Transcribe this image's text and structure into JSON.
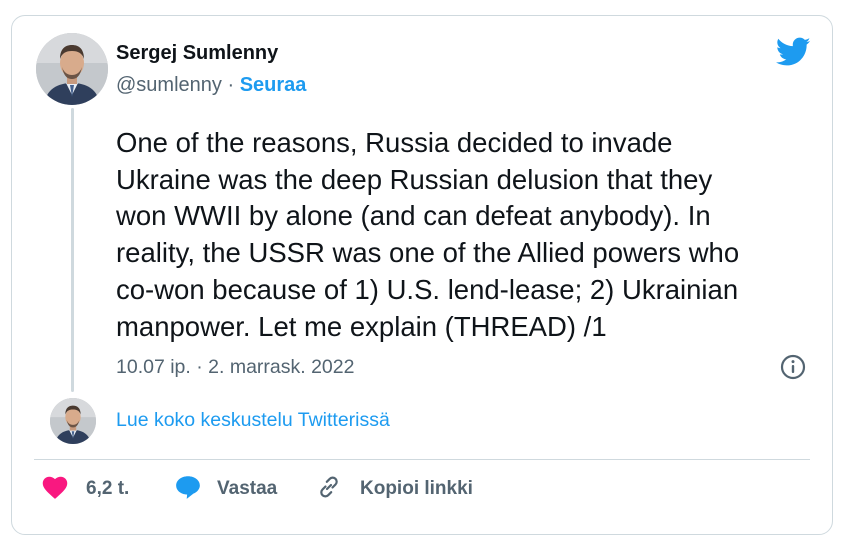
{
  "author": {
    "name": "Sergej Sumlenny",
    "handle": "@sumlenny",
    "separator": " · ",
    "follow_label": "Seuraa"
  },
  "tweet": {
    "lines": [
      "One of the reasons, Russia decided to invade",
      "Ukraine was the deep Russian delusion that they",
      "won WWII by alone (and can defeat anybody). In",
      "reality, the USSR was one of the Allied powers who",
      "co-won because of 1) U.S. lend-lease; 2) Ukrainian",
      "manpower. Let me explain (THREAD) /1"
    ],
    "timestamp": "10.07 ip. · 2. marrask. 2022"
  },
  "thread": {
    "read_more_label": "Lue koko keskustelu Twitterissä"
  },
  "actions": {
    "like_count": "6,2 t.",
    "reply_label": "Vastaa",
    "copy_link_label": "Kopioi linkki"
  },
  "icons": {
    "brand": "twitter-bird-icon",
    "info": "info-icon",
    "like": "heart-icon",
    "reply": "speech-bubble-icon",
    "copy": "link-icon"
  },
  "colors": {
    "accent": "#1d9bf0",
    "like": "#f91880",
    "text": "#0f1419",
    "muted": "#536471",
    "border": "#cfd9de"
  }
}
